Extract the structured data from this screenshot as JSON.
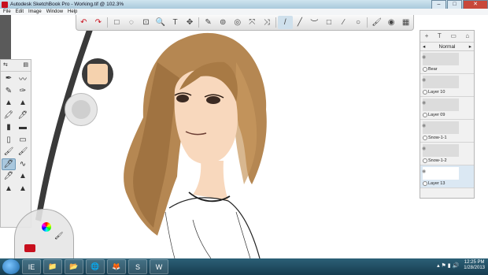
{
  "window": {
    "title": "Autodesk SketchBook Pro - Working.tif @ 102.3%"
  },
  "menu": [
    "File",
    "Edit",
    "Image",
    "Window",
    "Help"
  ],
  "toolbar": {
    "icons": [
      "undo-icon",
      "redo-icon",
      "rectangle-select-icon",
      "lasso-select-icon",
      "crop-icon",
      "zoom-icon",
      "text-icon",
      "move-icon",
      "ruler-icon",
      "ellipse-guide-icon",
      "french-curve-icon",
      "symmetry-x-icon",
      "symmetry-y-icon",
      "pen-icon",
      "line-icon",
      "curve-icon",
      "rect-shape-icon",
      "polyline-icon",
      "ellipse-shape-icon",
      "brush-palette-icon",
      "color-wheel-icon",
      "palette-swatches-icon"
    ],
    "glyphs": [
      "↶",
      "↷",
      "□",
      "◌",
      "⊡",
      "🔍",
      "T",
      "✥",
      "✎",
      "⊚",
      "◎",
      "⤧",
      "⤨",
      "/",
      "╱",
      "︶",
      "□",
      "∕",
      "○",
      "🖌",
      "◉",
      "▦"
    ]
  },
  "layers_panel": {
    "tools": [
      "+",
      "T",
      "▭",
      "⌂"
    ],
    "blend_mode": "Normal",
    "layers": [
      {
        "name": "Bear",
        "selected": false
      },
      {
        "name": "Layer 10",
        "selected": false
      },
      {
        "name": "Layer 09",
        "selected": false
      },
      {
        "name": "Snow-1-1",
        "selected": false
      },
      {
        "name": "Snow-1-2",
        "selected": false
      },
      {
        "name": "Layer 13",
        "selected": true
      }
    ]
  },
  "brush_palette": {
    "brushes": [
      "✒",
      "〰",
      "✎",
      "✑",
      "▲",
      "▲",
      "🖍",
      "🖊",
      "▮",
      "▬",
      "▯",
      "▭",
      "🖌",
      "🖌",
      "🖊",
      "∿",
      "🖊",
      "▲",
      "▲",
      "▲"
    ],
    "selected_index": 14,
    "badges": [
      "2",
      "3"
    ]
  },
  "colors": {
    "current_color": "#f5d2ae",
    "secondary": "#cfcfcf",
    "skin": "#f8d8bd",
    "hair": "#b58752"
  },
  "taskbar": {
    "apps": [
      "IE",
      "📁",
      "📂",
      "🌐",
      "🦊",
      "S",
      "W"
    ],
    "time": "12:25 PM",
    "date": "1/28/2013"
  }
}
